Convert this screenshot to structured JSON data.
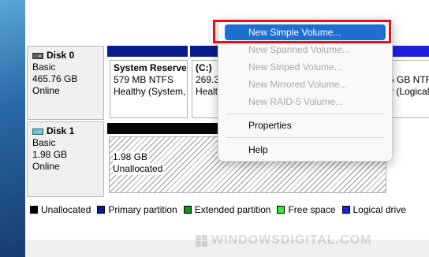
{
  "disks": [
    {
      "name": "Disk 0",
      "type": "Basic",
      "size": "465.76 GB",
      "status": "Online"
    },
    {
      "name": "Disk 1",
      "type": "Basic",
      "size": "1.98 GB",
      "status": "Online"
    }
  ],
  "disk0_partitions": [
    {
      "name": "System Reserve",
      "size": "579 MB NTFS",
      "status": "Healthy (System,"
    },
    {
      "name": "(C:)",
      "size": "269.3",
      "status": "Healt"
    },
    {
      "name": "",
      "size": "6 GB NTFS",
      "status": "y (Logical"
    }
  ],
  "disk1_partition": {
    "size": "1.98 GB",
    "status": "Unallocated"
  },
  "legend": [
    {
      "label": "Unallocated",
      "color": "#000000"
    },
    {
      "label": "Primary partition",
      "color": "#0a1b8c"
    },
    {
      "label": "Extended partition",
      "color": "#1a8a1a"
    },
    {
      "label": "Free space",
      "color": "#39e639"
    },
    {
      "label": "Logical drive",
      "color": "#1f1fe0"
    }
  ],
  "context_menu": {
    "items": [
      {
        "label": "New Simple Volume...",
        "state": "highlighted"
      },
      {
        "label": "New Spanned Volume...",
        "state": "disabled"
      },
      {
        "label": "New Striped Volume...",
        "state": "disabled"
      },
      {
        "label": "New Mirrored Volume...",
        "state": "disabled"
      },
      {
        "label": "New RAID-5 Volume...",
        "state": "disabled"
      },
      {
        "label": "Properties",
        "state": "enabled"
      },
      {
        "label": "Help",
        "state": "enabled"
      }
    ]
  },
  "watermark": "WINDOWSDIGITAL.COM",
  "colors": {
    "highlight": "#1f6fd1",
    "callout": "#e8101a",
    "primary_stripe": "#0a1b8c",
    "unallocated_stripe": "#000000"
  }
}
